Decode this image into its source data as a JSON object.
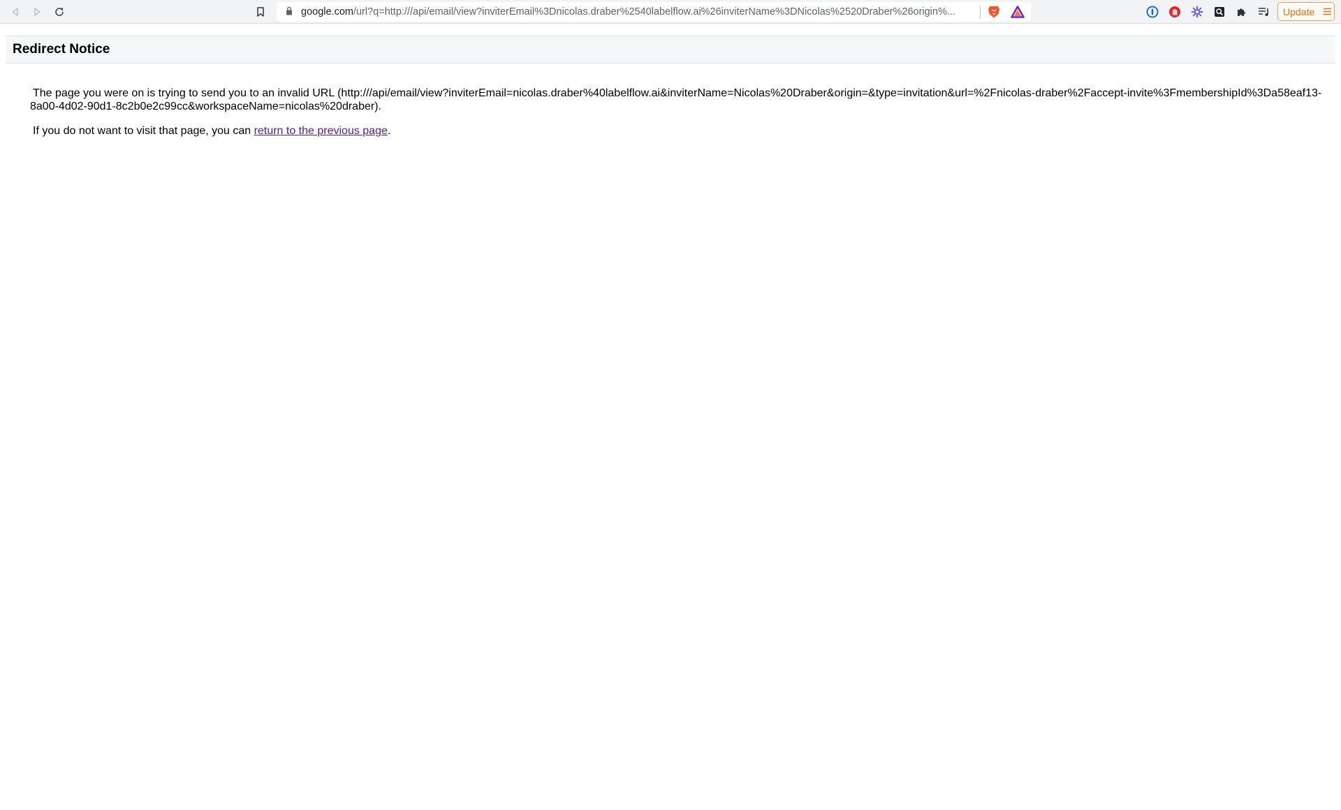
{
  "browser": {
    "url_domain": "google.com",
    "url_rest": "/url?q=http:///api/email/view?inviterEmail%3Dnicolas.draber%2540labelflow.ai%26inviterName%3DNicolas%2520Draber%26origin%...",
    "update_label": "Update",
    "icons": {
      "back": "back-arrow-icon",
      "forward": "forward-arrow-icon",
      "reload": "reload-icon",
      "bookmark": "bookmark-icon",
      "lock": "lock-icon",
      "brave_shields": "brave-lion-icon",
      "brave_rewards": "triangle-rewards-icon",
      "ext_1": "onepassword-icon",
      "ext_2": "adblock-hand-icon",
      "ext_3": "purple-gear-icon",
      "ext_4": "magnifier-icon",
      "ext_5": "puzzle-icon",
      "ext_6": "playlist-icon",
      "menu": "hamburger-icon"
    },
    "colors": {
      "update_accent": "#d8701d",
      "brave_orange": "#fb542b",
      "link_visited": "#551a8b"
    }
  },
  "page": {
    "title": "Redirect Notice",
    "invalid_url_message": "The page you were on is trying to send you to an invalid URL (http:///api/email/view?inviterEmail=nicolas.draber%40labelflow.ai&inviterName=Nicolas%20Draber&origin=&type=invitation&url=%2Fnicolas-draber%2Faccept-invite%3FmembershipId%3Da58eaf13-8a00-4d02-90d1-8c2b0e2c99cc&workspaceName=nicolas%20draber).",
    "return_prefix": "If you do not want to visit that page, you can ",
    "return_link": "return to the previous page",
    "return_suffix": "."
  }
}
